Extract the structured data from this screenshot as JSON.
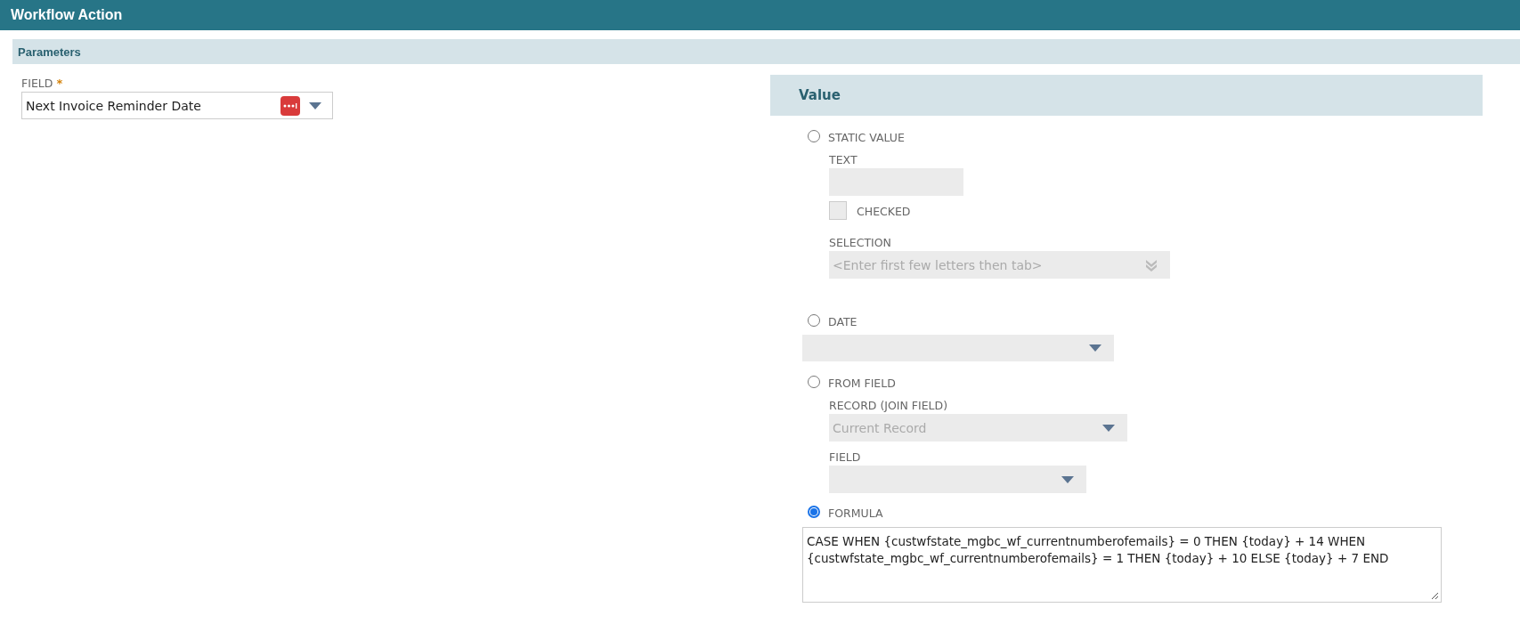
{
  "window": {
    "title": "Workflow Action"
  },
  "parameters": {
    "title": "Parameters",
    "field": {
      "label": "FIELD",
      "required_mark": "*",
      "value": "Next Invoice Reminder Date"
    }
  },
  "value_panel": {
    "title": "Value",
    "options": [
      {
        "kind": "static",
        "label": "STATIC VALUE",
        "selected": false,
        "text_label": "TEXT",
        "checkbox": {
          "label": "CHECKED",
          "checked": false
        },
        "selection": {
          "label": "SELECTION",
          "placeholder": "<Enter first few letters then tab>"
        }
      },
      {
        "kind": "date",
        "label": "DATE",
        "selected": false
      },
      {
        "kind": "from_field",
        "label": "FROM FIELD",
        "selected": false,
        "record": {
          "label": "RECORD (JOIN FIELD)",
          "value": "Current Record"
        },
        "field": {
          "label": "FIELD"
        }
      },
      {
        "kind": "formula",
        "label": "FORMULA",
        "selected": true,
        "value": "CASE WHEN {custwfstate_mgbc_wf_currentnumberofemails} = 0 THEN {today} + 14 WHEN {custwfstate_mgbc_wf_currentnumberofemails} = 1 THEN {today} + 10 ELSE {today} + 7 END"
      }
    ]
  }
}
